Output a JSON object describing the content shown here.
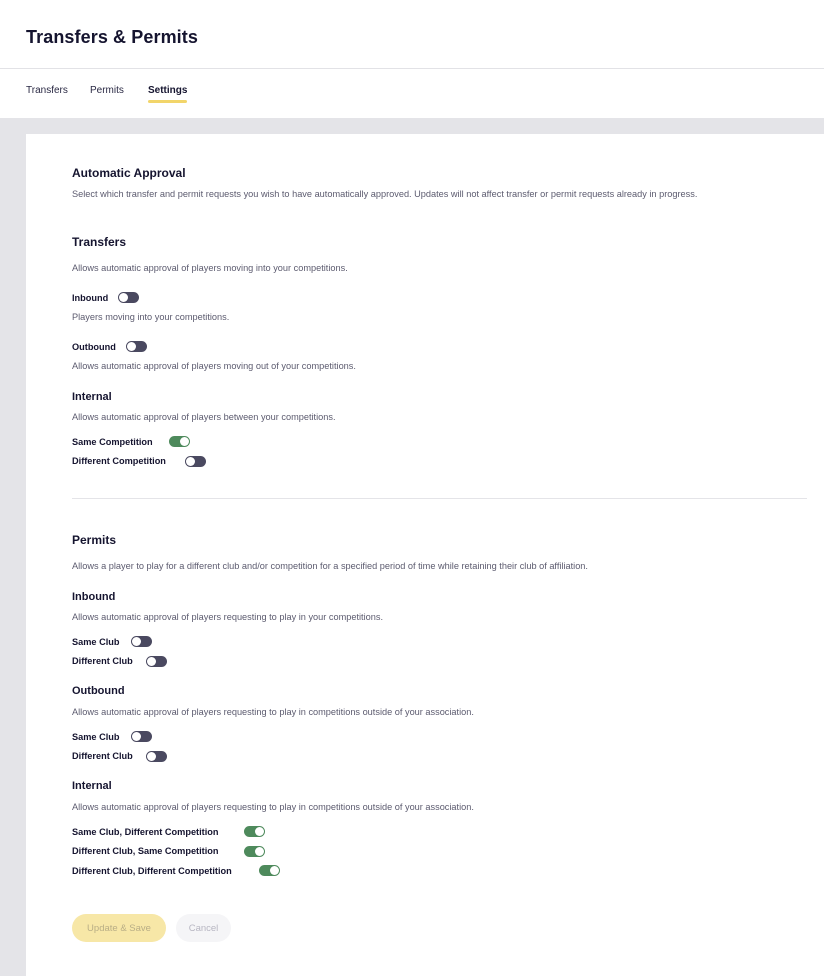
{
  "header": {
    "title": "Transfers & Permits"
  },
  "tabs": [
    {
      "label": "Transfers",
      "active": false
    },
    {
      "label": "Permits",
      "active": false
    },
    {
      "label": "Settings",
      "active": true
    }
  ],
  "auto_approval": {
    "title": "Automatic Approval",
    "description": "Select which transfer and permit requests you wish to have automatically approved. Updates will not affect transfer or permit requests already in progress."
  },
  "transfers": {
    "title": "Transfers",
    "description": "Allows automatic approval of players moving into your competitions.",
    "inbound": {
      "label": "Inbound",
      "on": false,
      "description": "Players moving into your competitions."
    },
    "outbound": {
      "label": "Outbound",
      "on": false,
      "description": "Allows automatic approval of players moving out of your competitions."
    },
    "internal": {
      "title": "Internal",
      "description": "Allows automatic approval of players between your competitions.",
      "options": [
        {
          "label": "Same Competition",
          "on": true
        },
        {
          "label": "Different Competition",
          "on": false
        }
      ]
    }
  },
  "permits": {
    "title": "Permits",
    "description": "Allows a player to play for a different club and/or competition for a specified period of time while retaining their club of affiliation.",
    "inbound": {
      "title": "Inbound",
      "description": "Allows automatic approval of players requesting to play in your competitions.",
      "options": [
        {
          "label": "Same Club",
          "on": false
        },
        {
          "label": "Different Club",
          "on": false
        }
      ]
    },
    "outbound": {
      "title": "Outbound",
      "description": "Allows automatic approval of players requesting to play in competitions outside of your association.",
      "options": [
        {
          "label": "Same Club",
          "on": false
        },
        {
          "label": "Different Club",
          "on": false
        }
      ]
    },
    "internal": {
      "title": "Internal",
      "description": "Allows automatic approval of players requesting to play in competitions outside of your association.",
      "options": [
        {
          "label": "Same Club, Different Competition",
          "on": true
        },
        {
          "label": "Different Club, Same Competition",
          "on": true
        },
        {
          "label": "Different Club, Different Competition",
          "on": true
        }
      ]
    }
  },
  "actions": {
    "save_label": "Update & Save",
    "cancel_label": "Cancel"
  }
}
